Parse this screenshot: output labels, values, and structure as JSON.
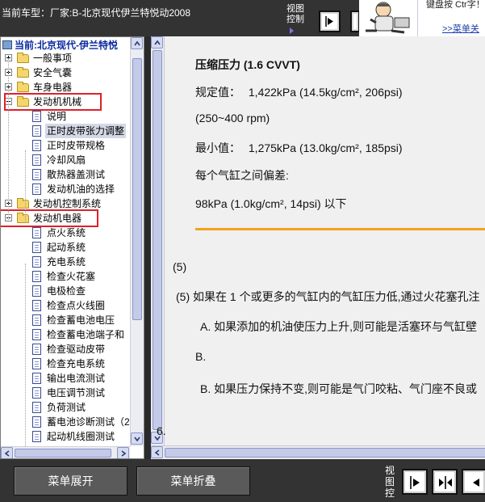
{
  "header": {
    "vehicle_title": "当前车型：厂家:B-北京现代伊兰特悦动2008",
    "view_control_label": "视图控制",
    "promo_text": "键盘按  Ctr字！",
    "promo_link": ">>菜单关"
  },
  "tree": {
    "header": "当前:北京现代-伊兰特悦",
    "items": [
      {
        "label": "一般事项",
        "kind": "folder",
        "state": "collapsed"
      },
      {
        "label": "安全气囊",
        "kind": "folder",
        "state": "collapsed"
      },
      {
        "label": "车身电器",
        "kind": "folder",
        "state": "collapsed"
      },
      {
        "label": "发动机机械",
        "kind": "folder",
        "state": "expanded",
        "highlighted": true
      },
      {
        "label": "说明",
        "kind": "doc"
      },
      {
        "label": "正时皮带张力调整",
        "kind": "doc",
        "selected": true
      },
      {
        "label": "正时皮带规格",
        "kind": "doc"
      },
      {
        "label": "冷却风扇",
        "kind": "doc"
      },
      {
        "label": "散热器盖测试",
        "kind": "doc"
      },
      {
        "label": "发动机油的选择",
        "kind": "doc"
      },
      {
        "label": "发动机控制系统",
        "kind": "folder",
        "state": "collapsed"
      },
      {
        "label": "发动机电器",
        "kind": "folder",
        "state": "expanded",
        "highlighted": true
      },
      {
        "label": "点火系统",
        "kind": "doc"
      },
      {
        "label": "起动系统",
        "kind": "doc"
      },
      {
        "label": "充电系统",
        "kind": "doc"
      },
      {
        "label": "检查火花塞",
        "kind": "doc"
      },
      {
        "label": "电极检查",
        "kind": "doc"
      },
      {
        "label": "检查点火线圈",
        "kind": "doc"
      },
      {
        "label": "检查蓄电池电压",
        "kind": "doc"
      },
      {
        "label": "检查蓄电池端子和",
        "kind": "doc"
      },
      {
        "label": "检查驱动皮带",
        "kind": "doc"
      },
      {
        "label": "检查充电系统",
        "kind": "doc"
      },
      {
        "label": "输出电流测试",
        "kind": "doc"
      },
      {
        "label": "电压调节测试",
        "kind": "doc"
      },
      {
        "label": "负荷测试",
        "kind": "doc"
      },
      {
        "label": "蓄电池诊断测试（2",
        "kind": "doc"
      },
      {
        "label": "起动机线圈测试",
        "kind": "doc"
      }
    ]
  },
  "content": {
    "heading": "压缩压力 (1.6 CVVT)",
    "spec_label": "规定值：",
    "spec_value": "1,422kPa (14.5kg/cm², 206psi)",
    "rpm_range": "(250~400 rpm)",
    "min_label": "最小值：",
    "min_value": "1,275kPa (13.0kg/cm², 185psi)",
    "deviation_label": "每个气缸之间偏差:",
    "deviation_value": "98kPa (1.0kg/cm², 14psi)  以下",
    "step5_number": "(5)",
    "step5_text": "(5)  如果在 1 个或更多的气缸内的气缸压力低,通过火花塞孔注",
    "stepA1_text": "A.  如果添加的机油使压力上升,则可能是活塞环与气缸壁",
    "stepB1_text": "B.",
    "stepB2_text": "B.  如果压力保持不变,则可能是气门咬粘、气门座不良或",
    "step6_number": "6."
  },
  "footer": {
    "expand_label": "菜单展开",
    "collapse_label": "菜单折叠",
    "view_control_label": "视图控"
  },
  "colors": {
    "highlight_box": "#e0202a",
    "orange_rule": "#f4a21c",
    "tree_header_text": "#0a2aa0"
  }
}
